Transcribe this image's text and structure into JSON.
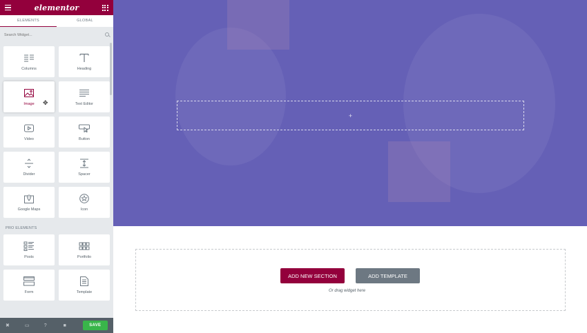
{
  "sidebar": {
    "logo": "elementor",
    "tabs": [
      {
        "label": "ELEMENTS"
      },
      {
        "label": "GLOBAL"
      }
    ],
    "search_placeholder": "Search Widget...",
    "widgets": [
      {
        "label": "Columns",
        "icon": "columns-icon"
      },
      {
        "label": "Heading",
        "icon": "heading-icon"
      },
      {
        "label": "Image",
        "icon": "image-icon"
      },
      {
        "label": "Text Editor",
        "icon": "text-editor-icon"
      },
      {
        "label": "Video",
        "icon": "video-icon"
      },
      {
        "label": "Button",
        "icon": "button-icon"
      },
      {
        "label": "Divider",
        "icon": "divider-icon"
      },
      {
        "label": "Spacer",
        "icon": "spacer-icon"
      },
      {
        "label": "Google Maps",
        "icon": "google-maps-icon"
      },
      {
        "label": "Icon",
        "icon": "star-icon"
      }
    ],
    "pro_section_title": "PRO ELEMENTS",
    "pro_widgets": [
      {
        "label": "Posts",
        "icon": "posts-icon"
      },
      {
        "label": "Portfolio",
        "icon": "portfolio-icon"
      },
      {
        "label": "Form",
        "icon": "form-icon"
      },
      {
        "label": "Template",
        "icon": "template-icon"
      }
    ],
    "save_label": "SAVE"
  },
  "canvas": {
    "add_section_label": "ADD NEW SECTION",
    "add_template_label": "ADD TEMPLATE",
    "drag_hint": "Or drag widget here"
  },
  "colors": {
    "brand": "#93003c",
    "hero_overlay": "#6560b6",
    "save_green": "#39b54a",
    "template_gray": "#6d7882"
  }
}
